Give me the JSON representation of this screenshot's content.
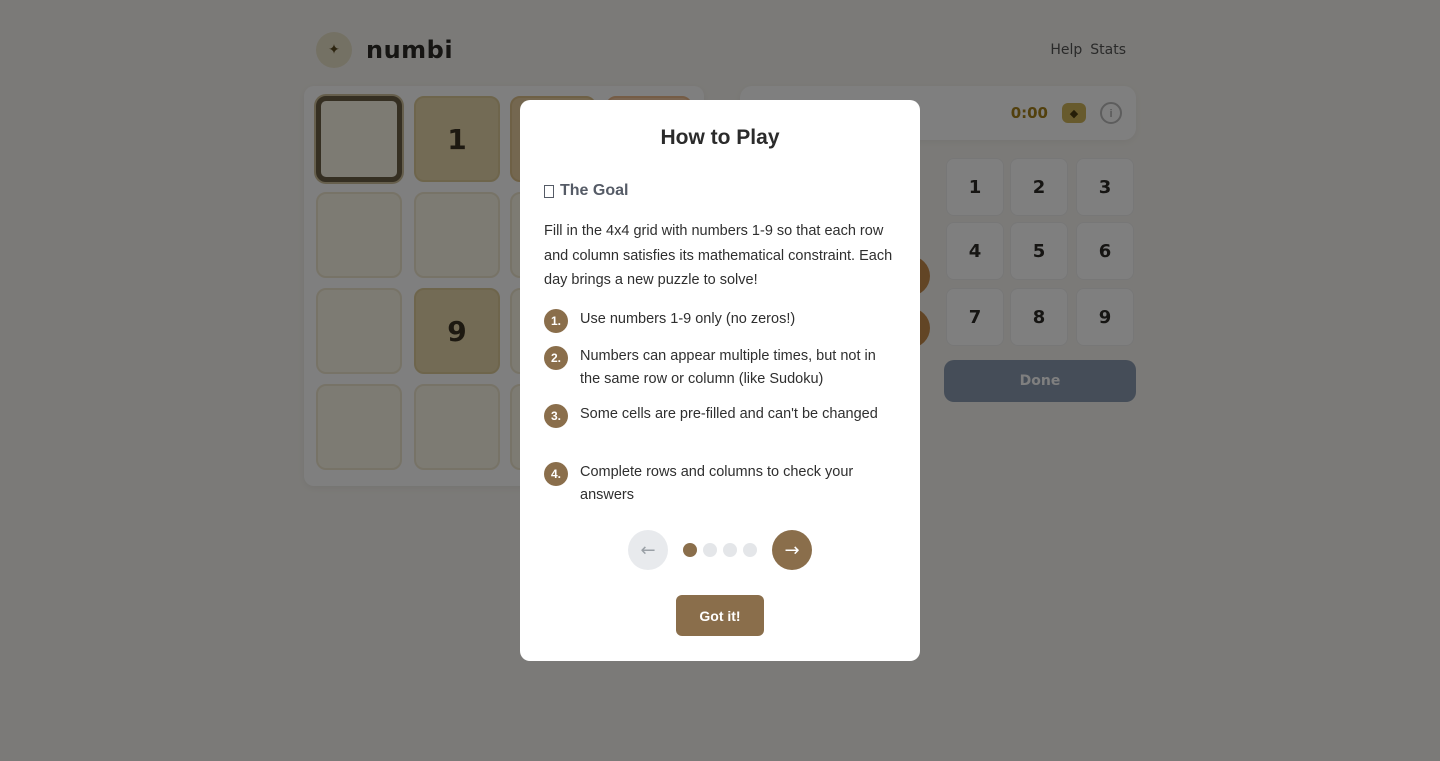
{
  "app": {
    "brand_name": "numbi",
    "logo_icon": "sparkle-icon",
    "help_label": "Help",
    "stats_label": "Stats",
    "timer": "0:00",
    "done_label": "Done",
    "board_cells": [
      "",
      "1",
      "",
      "",
      "",
      "",
      "",
      "",
      "",
      "9",
      "",
      "",
      "",
      "",
      "",
      ""
    ],
    "numpad": [
      "1",
      "2",
      "3",
      "4",
      "5",
      "6",
      "7",
      "8",
      "9"
    ]
  },
  "modal": {
    "title": "How to Play",
    "section_icon": "target-icon",
    "section_title": "The Goal",
    "intro": "Fill in the 4x4 grid with numbers 1-9 so that each row and column satisfies its mathematical constraint. Each day brings a new puzzle to solve!",
    "steps": [
      {
        "num": "1.",
        "text": "Use numbers 1-9 only (no zeros!)"
      },
      {
        "num": "2.",
        "text": "Numbers can appear multiple times, but not in the same row or column (like Sudoku)"
      },
      {
        "num": "3.",
        "text": "Some cells are pre-filled and can't be changed"
      },
      {
        "num": "4.",
        "text": "Complete rows and columns to check your answers"
      }
    ],
    "prev_arrow": "←",
    "next_arrow": "→",
    "page_total": 4,
    "page_current": 1,
    "confirm_label": "Got it!"
  },
  "colors": {
    "accent": "#8a6e4b",
    "overlay": "rgba(0,0,0,0.5)"
  }
}
